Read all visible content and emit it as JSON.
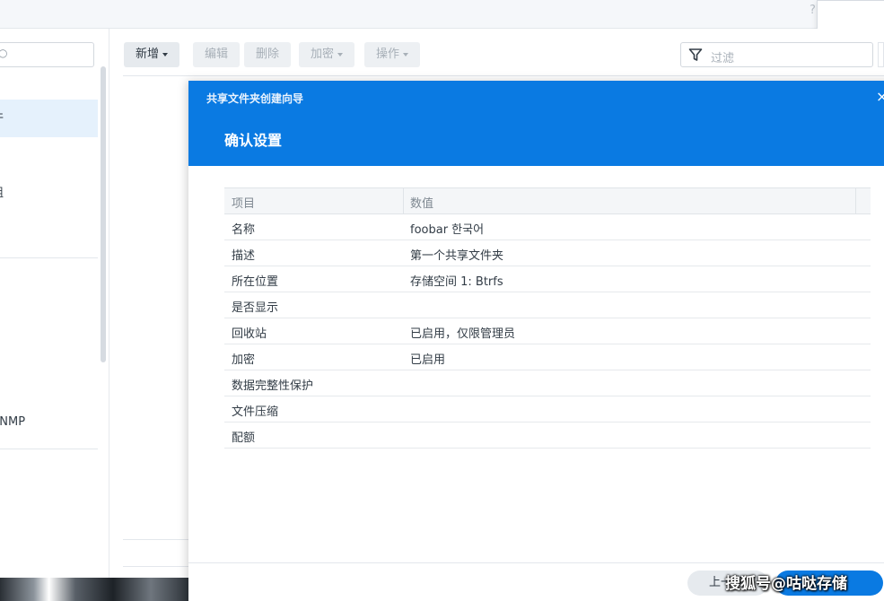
{
  "app": {
    "help_glyph": "?"
  },
  "sidebar": {
    "search_placeholder": "",
    "items": [
      {
        "label": "件",
        "active": true
      },
      {
        "label": "组",
        "active": false
      },
      {
        "label": "SNMP",
        "active": false
      }
    ]
  },
  "toolbar": {
    "add_label": "新增",
    "edit_label": "编辑",
    "delete_label": "删除",
    "encrypt_label": "加密",
    "action_label": "操作",
    "filter_placeholder": "过滤"
  },
  "dialog": {
    "wizard_title": "共享文件夹创建向导",
    "step_title": "确认设置",
    "close_glyph": "×",
    "table": {
      "headers": [
        "项目",
        "数值"
      ],
      "rows": [
        {
          "item": "名称",
          "value": "foobar 한국어"
        },
        {
          "item": "描述",
          "value": "第一个共享文件夹"
        },
        {
          "item": "所在位置",
          "value": "存储空间 1:  Btrfs"
        },
        {
          "item": "是否显示",
          "value": ""
        },
        {
          "item": "回收站",
          "value": "已启用，仅限管理员"
        },
        {
          "item": "加密",
          "value": "已启用"
        },
        {
          "item": "数据完整性保护",
          "value": ""
        },
        {
          "item": "文件压缩",
          "value": ""
        },
        {
          "item": "配额",
          "value": ""
        }
      ]
    },
    "prev_button_label": "上一步"
  },
  "watermark": "搜狐号@咕哒存储",
  "colors": {
    "header_blue": "#0a7ae2",
    "active_item_bg": "#e5f1fc"
  }
}
